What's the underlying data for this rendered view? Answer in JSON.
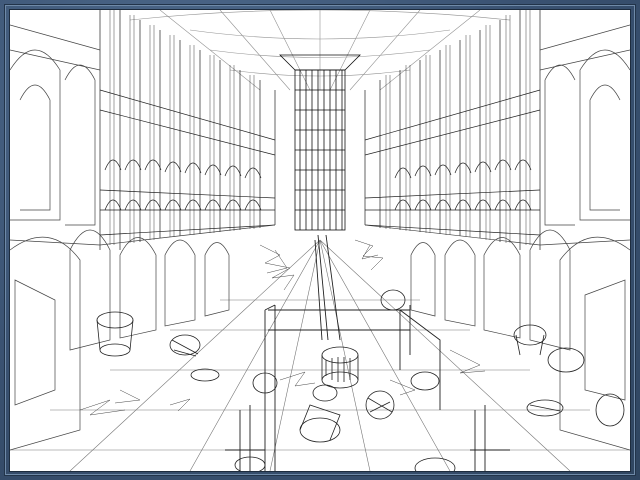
{
  "scene": {
    "render_mode": "wireframe",
    "subject": "cathedral-interior",
    "colors": {
      "frame_bg": "#3d5470",
      "viewport_bg": "#ffffff",
      "line": "#1f1f1f",
      "line_light": "#8a8a8a"
    }
  }
}
